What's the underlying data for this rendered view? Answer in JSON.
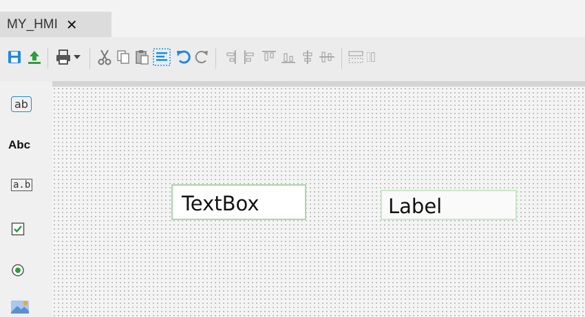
{
  "tab": {
    "title": "MY_HMI",
    "close_glyph": "✕"
  },
  "toolbar": {
    "items": [
      "save-icon",
      "upload-icon",
      "print-icon",
      "cut-icon",
      "copy-icon",
      "paste-icon",
      "select-all-icon",
      "undo-icon",
      "redo-icon",
      "align-left-icon",
      "align-center-icon",
      "align-top-icon",
      "align-bottom-icon",
      "align-middle-icon",
      "distribute-icon"
    ]
  },
  "toolbox": {
    "textbox_glyph": "ab",
    "label_glyph": "Abc",
    "input_glyph": "a.b"
  },
  "canvas": {
    "textbox_text": "TextBox",
    "label_text": "Label"
  },
  "colors": {
    "accent_blue": "#1e88e5",
    "accent_green": "#2e9d3a",
    "widget_border": "#a9d8a6"
  }
}
